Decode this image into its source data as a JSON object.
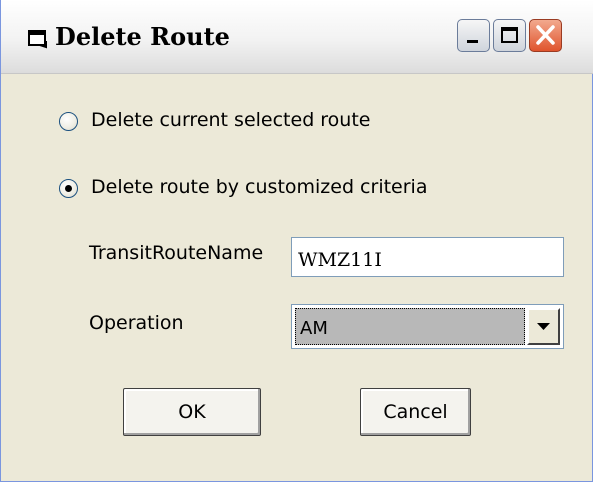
{
  "window": {
    "title": "Delete Route"
  },
  "titlebar_buttons": {
    "minimize": "minimize-icon",
    "maximize": "maximize-icon",
    "close": "close-icon"
  },
  "options": {
    "current": {
      "label": "Delete current selected route",
      "checked": false
    },
    "criteria": {
      "label": "Delete route by customized criteria",
      "checked": true
    }
  },
  "fields": {
    "route_name": {
      "label": "TransitRouteName",
      "value": "WMZ11I"
    },
    "operation": {
      "label": "Operation",
      "value": "AM"
    }
  },
  "buttons": {
    "ok": "OK",
    "cancel": "Cancel"
  },
  "colors": {
    "title_bar": "#f2f2f2",
    "dialog_face": "#ece9d8",
    "close_button": "#e0542d"
  }
}
